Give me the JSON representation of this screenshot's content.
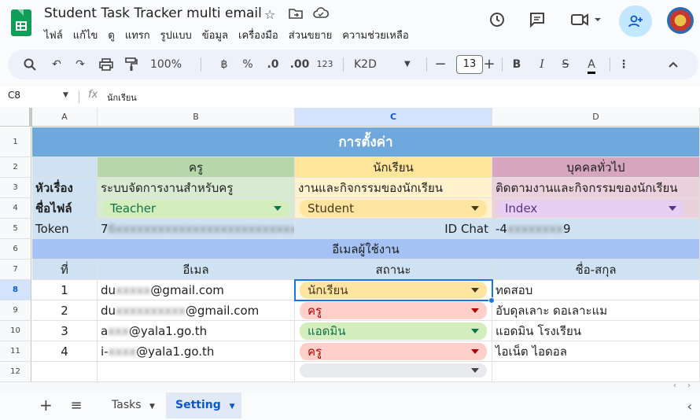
{
  "doc": {
    "title": "Student Task Tracker multi email",
    "menu": [
      "ไฟล์",
      "แก้ไข",
      "ดู",
      "แทรก",
      "รูปแบบ",
      "ข้อมูล",
      "เครื่องมือ",
      "ส่วนขยาย",
      "ความช่วยเหลือ"
    ]
  },
  "toolbar": {
    "zoom": "100%",
    "baht": "฿",
    "percent": "%",
    "dec_less": ".0",
    "dec_more": ".00",
    "num_format": "123",
    "font": "K2D",
    "font_size": "13"
  },
  "formula": {
    "cell_ref": "C8",
    "fx": "fx",
    "value": "นักเรียน"
  },
  "columns": [
    "A",
    "B",
    "C",
    "D"
  ],
  "rows": [
    "1",
    "2",
    "3",
    "4",
    "5",
    "6",
    "7",
    "8",
    "9",
    "10",
    "11",
    "12"
  ],
  "sheet": {
    "r1_title": "การตั้งค่า",
    "r2": {
      "b": "ครู",
      "c": "นักเรียน",
      "d": "บุคคลทั่วไป"
    },
    "r3": {
      "a": "หัวเรื่อง",
      "b": "ระบบจัดการงานสำหรับครู",
      "c": "งานและกิจกรรมของนักเรียน",
      "d": "ติดตามงานและกิจกรรมของนักเรียน"
    },
    "r4": {
      "a": "ชื่อไฟล์",
      "b": "Teacher",
      "c": "Student",
      "d": "Index"
    },
    "r5": {
      "a": "Token",
      "b_pre": "7",
      "b_blur": "6xxxxxxxxxxxxxxxxxxxxxxxxxx",
      "c": "ID Chat",
      "d_pre": "-4",
      "d_blur": "xxxxxxxx",
      "d_post": "9"
    },
    "r6": "อีเมลผู้ใช้งาน",
    "r7": {
      "a": "ที่",
      "b": "อีเมล",
      "c": "สถานะ",
      "d": "ชื่อ-สกุล"
    },
    "users": [
      {
        "no": "1",
        "email_pre": "du",
        "email_blur": "xxxxx",
        "email_post": "@gmail.com",
        "status": "นักเรียน",
        "name": "ทดสอบ"
      },
      {
        "no": "2",
        "email_pre": "du",
        "email_blur": "xxxxxxxxxx",
        "email_post": "@gmail.com",
        "status": "ครู",
        "name": "อับดุลเลาะ ดอเลาะแม"
      },
      {
        "no": "3",
        "email_pre": "a",
        "email_blur": "xxx",
        "email_post": "@yala1.go.th",
        "status": "แอดมิน",
        "name": "แอดมิน โรงเรียน"
      },
      {
        "no": "4",
        "email_pre": "i-",
        "email_blur": "xxxx",
        "email_post": "@yala1.go.th",
        "status": "ครู",
        "name": "ไอเน็ต ไอดอล"
      }
    ]
  },
  "tabs": {
    "add": "+",
    "list": "≡",
    "tasks": "Tasks",
    "setting": "Setting"
  },
  "colors": {
    "teacher": "#b6d7a8",
    "student": "#ffe599",
    "general": "#d5a6bd",
    "header_blue": "#6fa8dc",
    "light_blue": "#cfe2f3"
  }
}
